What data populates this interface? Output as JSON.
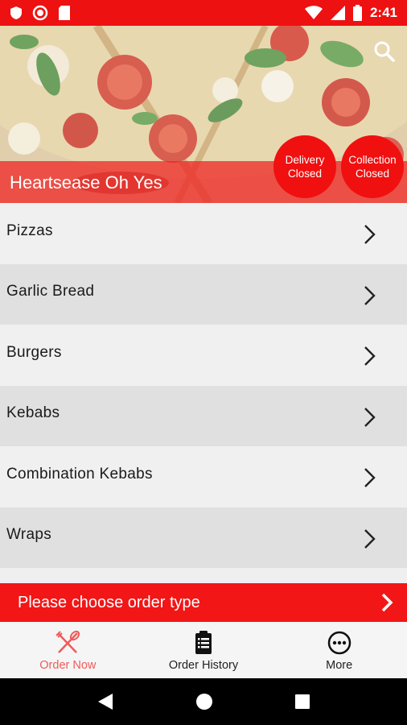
{
  "status_bar": {
    "time": "2:41"
  },
  "restaurant": {
    "name": "Heartsease Oh Yes"
  },
  "badges": {
    "delivery": {
      "line1": "Delivery",
      "line2": "Closed"
    },
    "collection": {
      "line1": "Collection",
      "line2": "Closed"
    }
  },
  "menu": {
    "items": [
      {
        "label": "Pizzas"
      },
      {
        "label": "Garlic Bread"
      },
      {
        "label": "Burgers"
      },
      {
        "label": "Kebabs"
      },
      {
        "label": "Combination Kebabs"
      },
      {
        "label": "Wraps"
      }
    ]
  },
  "order_bar": {
    "label": "Please choose order type"
  },
  "tabs": [
    {
      "label": "Order Now",
      "icon": "fork-knife-icon",
      "active": true
    },
    {
      "label": "Order History",
      "icon": "clipboard-icon",
      "active": false
    },
    {
      "label": "More",
      "icon": "more-dots-icon",
      "active": false
    }
  ],
  "colors": {
    "accent": "#f21616",
    "active_tab": "#f05a5a",
    "row_light": "#f0f0f0",
    "row_dark": "#e0e0e0"
  }
}
